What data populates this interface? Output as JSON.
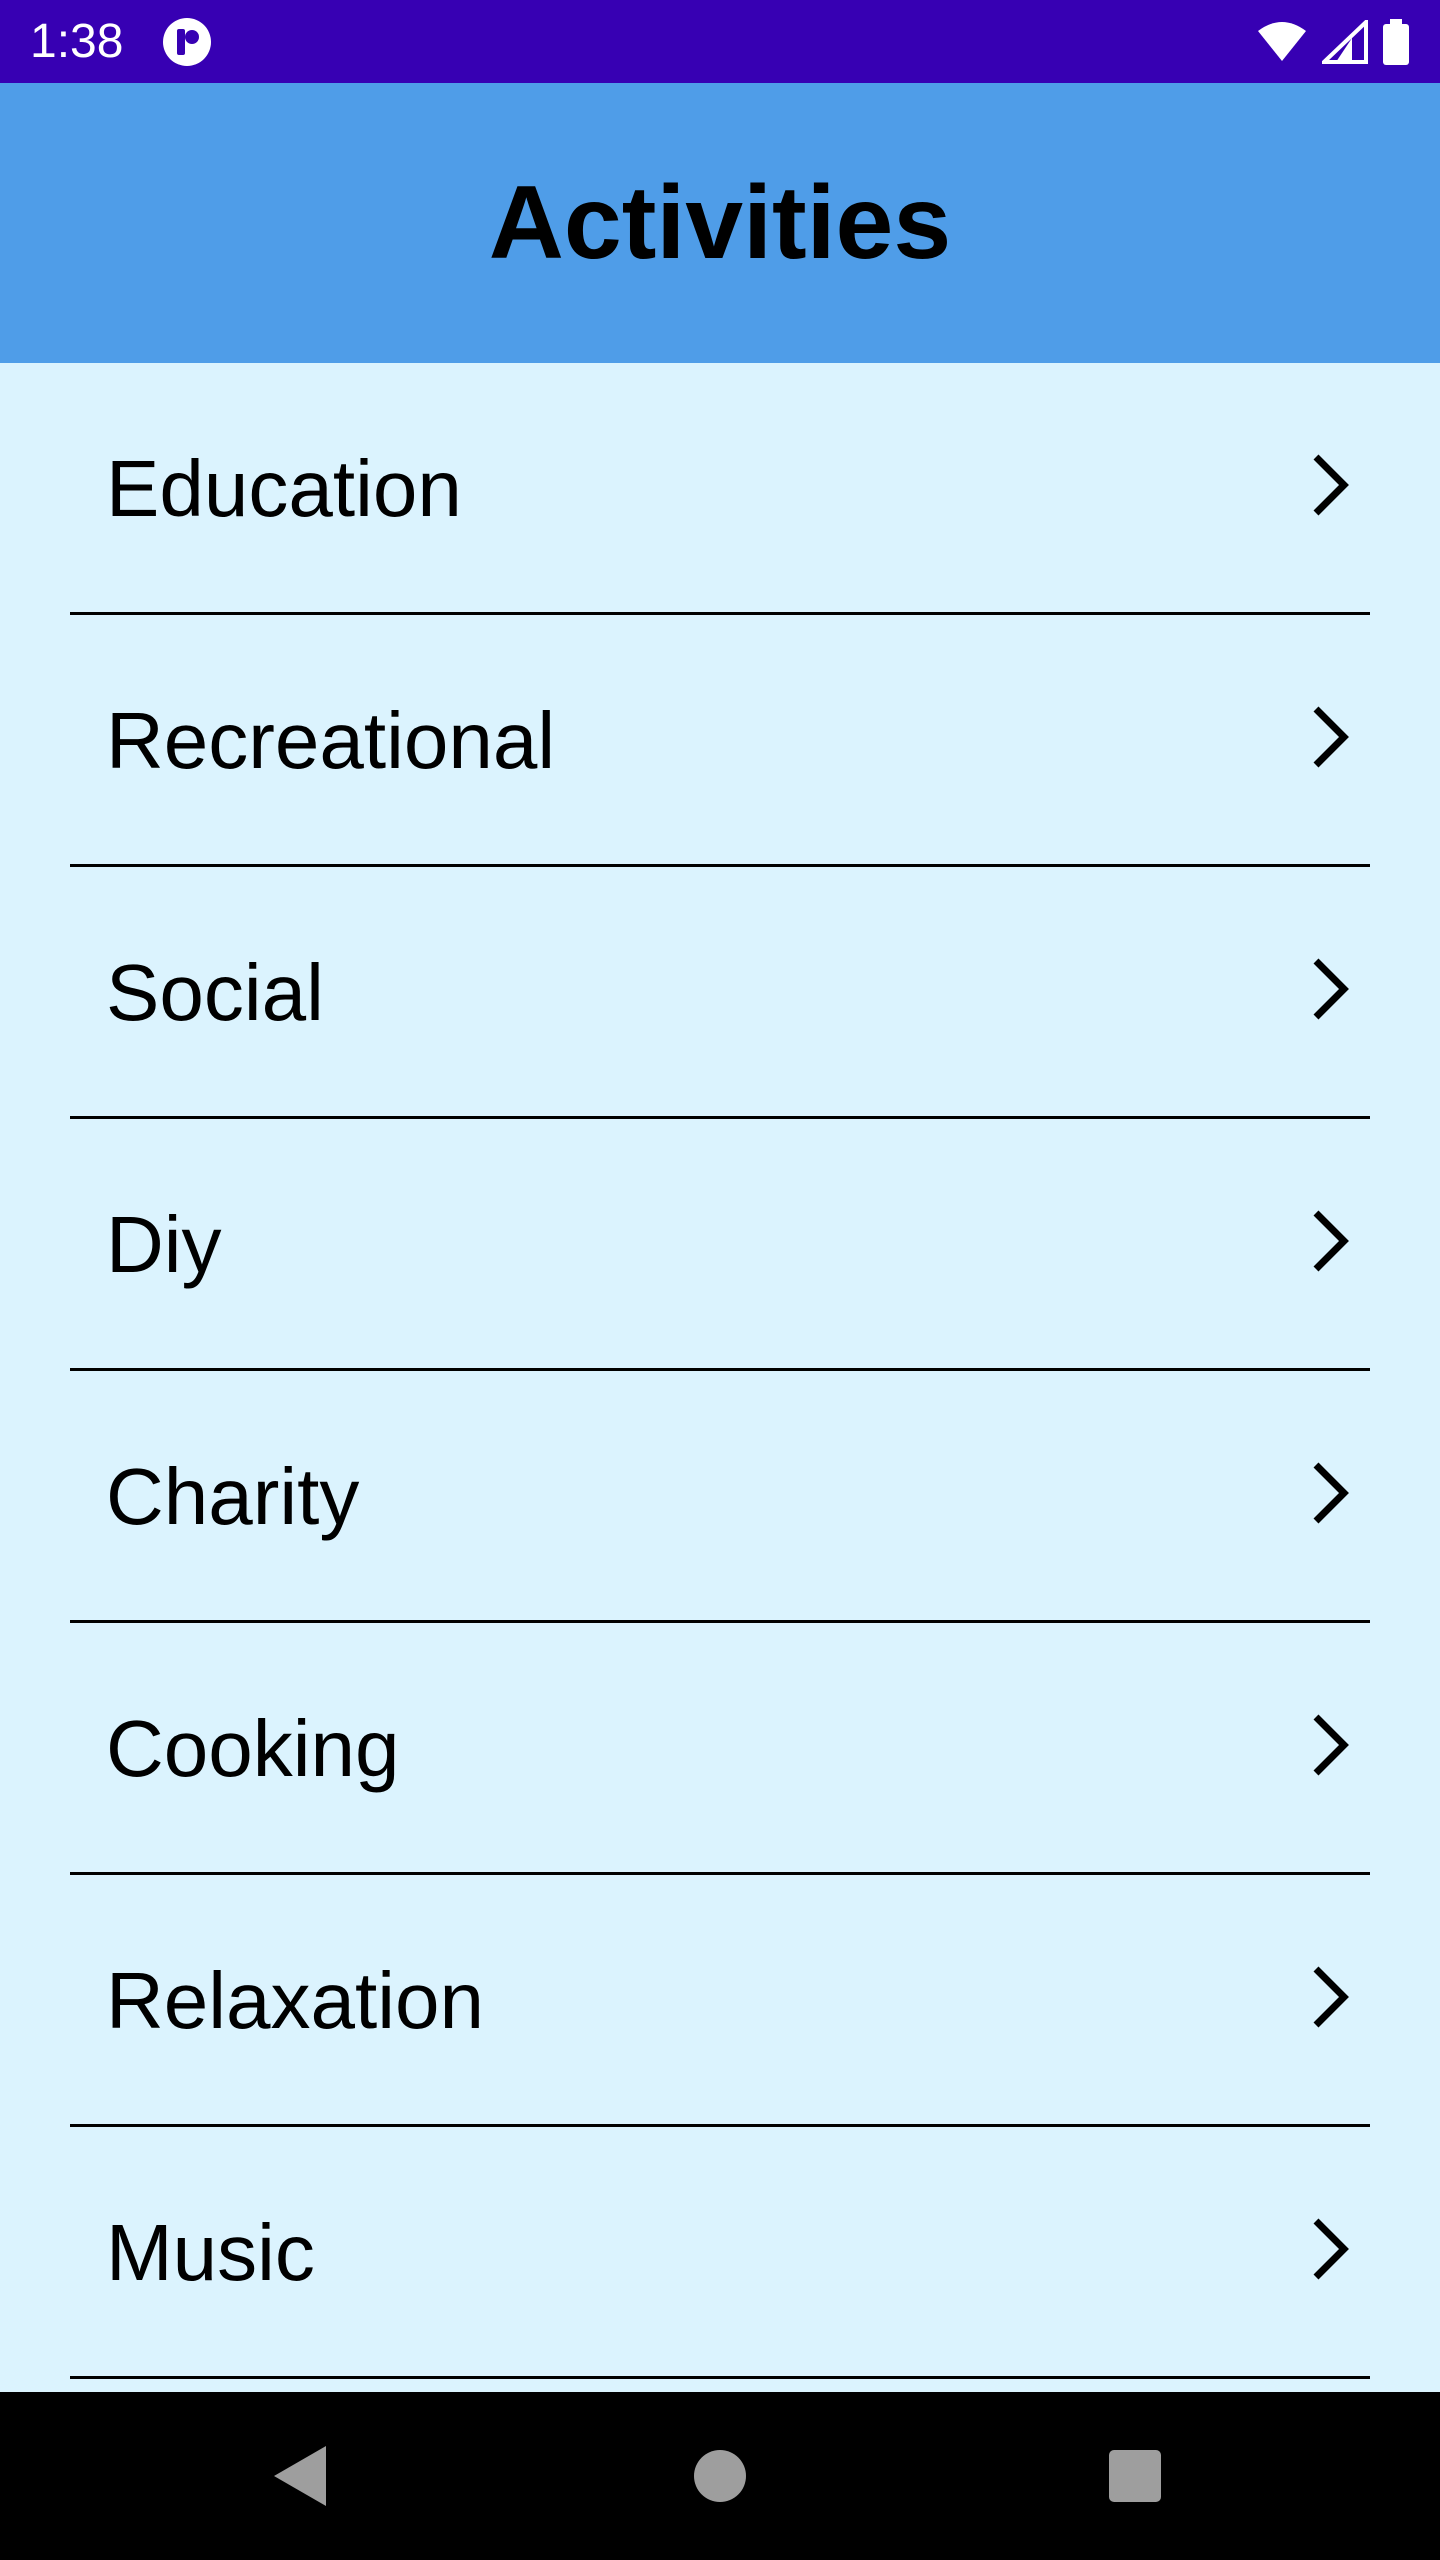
{
  "status_bar": {
    "time": "1:38",
    "background_color": "#3700B3",
    "icons": [
      "app-notification-icon",
      "wifi-icon",
      "signal-icon",
      "battery-icon"
    ]
  },
  "app_bar": {
    "title": "Activities",
    "background_color": "#4F9DE8"
  },
  "list": {
    "background_color": "#DBF3FE",
    "items": [
      {
        "label": "Education"
      },
      {
        "label": "Recreational"
      },
      {
        "label": "Social"
      },
      {
        "label": "Diy"
      },
      {
        "label": "Charity"
      },
      {
        "label": "Cooking"
      },
      {
        "label": "Relaxation"
      },
      {
        "label": "Music"
      }
    ],
    "item_icon": "chevron-right-icon"
  },
  "nav_bar": {
    "buttons": [
      "back-icon",
      "home-icon",
      "recents-icon"
    ]
  }
}
